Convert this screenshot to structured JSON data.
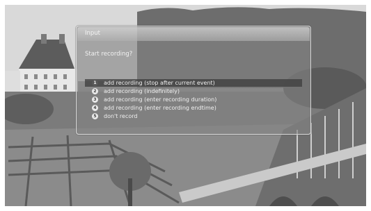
{
  "dialog": {
    "title": "Input",
    "prompt": "Start recording?",
    "options": [
      {
        "number": "1",
        "label": "add recording (stop after current event)",
        "selected": true
      },
      {
        "number": "2",
        "label": "add recording (indefinitely)",
        "selected": false
      },
      {
        "number": "3",
        "label": "add recording (enter recording duration)",
        "selected": false
      },
      {
        "number": "4",
        "label": "add recording (enter recording endtime)",
        "selected": false
      },
      {
        "number": "5",
        "label": "don't record",
        "selected": false
      }
    ]
  }
}
